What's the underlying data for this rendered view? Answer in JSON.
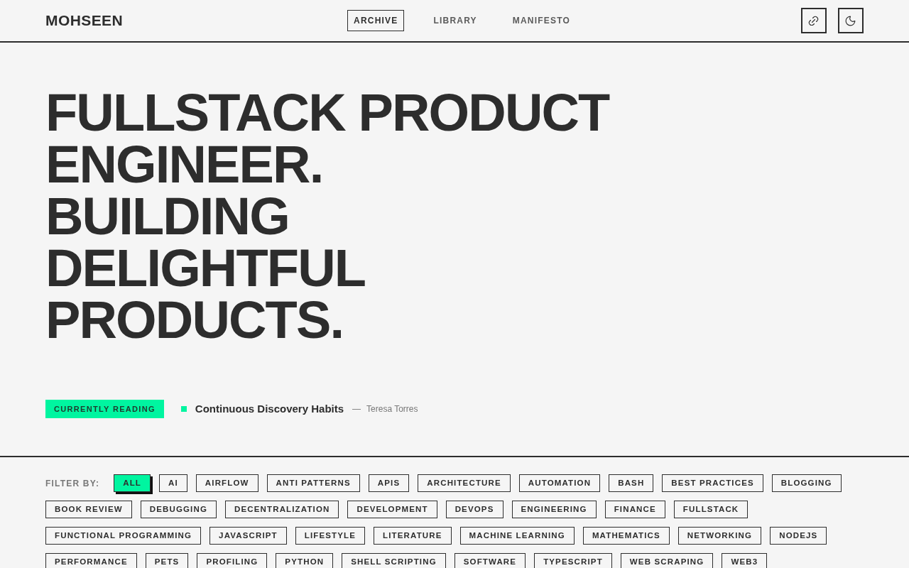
{
  "header": {
    "logo": "MOHSEEN",
    "nav": [
      {
        "label": "ARCHIVE",
        "selected": true
      },
      {
        "label": "LIBRARY",
        "selected": false
      },
      {
        "label": "MANIFESTO",
        "selected": false
      }
    ]
  },
  "hero": {
    "headline": [
      "FULLSTACK PRODUCT ENGINEER.",
      "BUILDING DELIGHTFUL PRODUCTS."
    ]
  },
  "currently_reading": {
    "badge": "CURRENTLY READING",
    "title": "Continuous Discovery Habits",
    "separator": "—",
    "author": "Teresa Torres"
  },
  "filter": {
    "label": "FILTER BY:",
    "tags": [
      {
        "label": "ALL",
        "selected": true
      },
      {
        "label": "AI",
        "selected": false
      },
      {
        "label": "AIRFLOW",
        "selected": false
      },
      {
        "label": "ANTI PATTERNS",
        "selected": false
      },
      {
        "label": "APIS",
        "selected": false
      },
      {
        "label": "ARCHITECTURE",
        "selected": false
      },
      {
        "label": "AUTOMATION",
        "selected": false
      },
      {
        "label": "BASH",
        "selected": false
      },
      {
        "label": "BEST PRACTICES",
        "selected": false
      },
      {
        "label": "BLOGGING",
        "selected": false
      },
      {
        "label": "BOOK REVIEW",
        "selected": false
      },
      {
        "label": "DEBUGGING",
        "selected": false
      },
      {
        "label": "DECENTRALIZATION",
        "selected": false
      },
      {
        "label": "DEVELOPMENT",
        "selected": false
      },
      {
        "label": "DEVOPS",
        "selected": false
      },
      {
        "label": "ENGINEERING",
        "selected": false
      },
      {
        "label": "FINANCE",
        "selected": false
      },
      {
        "label": "FULLSTACK",
        "selected": false
      },
      {
        "label": "FUNCTIONAL PROGRAMMING",
        "selected": false
      },
      {
        "label": "JAVASCRIPT",
        "selected": false
      },
      {
        "label": "LIFESTYLE",
        "selected": false
      },
      {
        "label": "LITERATURE",
        "selected": false
      },
      {
        "label": "MACHINE LEARNING",
        "selected": false
      },
      {
        "label": "MATHEMATICS",
        "selected": false
      },
      {
        "label": "NETWORKING",
        "selected": false
      },
      {
        "label": "NODEJS",
        "selected": false
      },
      {
        "label": "PERFORMANCE",
        "selected": false
      },
      {
        "label": "PETS",
        "selected": false
      },
      {
        "label": "PROFILING",
        "selected": false
      },
      {
        "label": "PYTHON",
        "selected": false
      },
      {
        "label": "SHELL SCRIPTING",
        "selected": false
      },
      {
        "label": "SOFTWARE",
        "selected": false
      },
      {
        "label": "TYPESCRIPT",
        "selected": false
      },
      {
        "label": "WEB SCRAPING",
        "selected": false
      },
      {
        "label": "WEB3",
        "selected": false
      }
    ]
  }
}
